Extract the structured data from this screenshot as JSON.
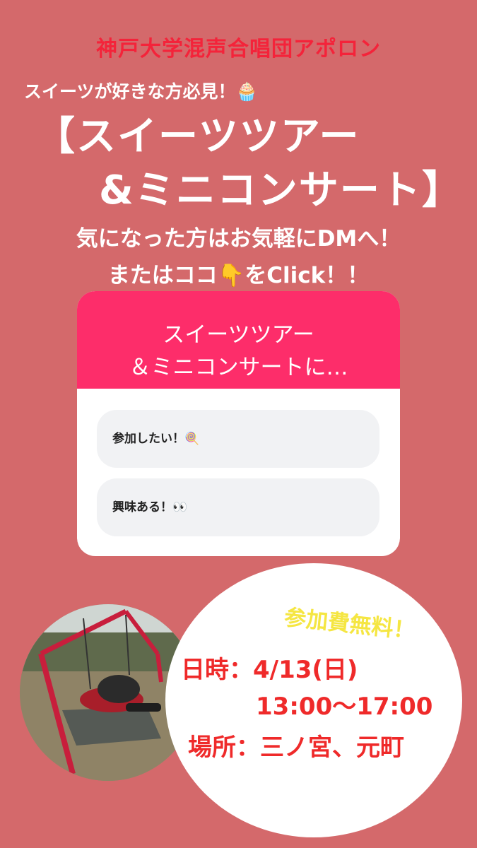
{
  "organization": "神戸大学混声合唱団アポロン",
  "tagline": "スイーツが好きな方必見！🧁",
  "title_line1": "【スイーツツアー",
  "title_line2": "&ミニコンサート】",
  "subtext_line1": "気になった方はお気軽にDMへ！",
  "subtext_line2": "またはココ👇をClick！！",
  "poll": {
    "question_line1": "スイーツツアー",
    "question_line2": "＆ミニコンサートに…",
    "options": [
      {
        "label": "参加したい！🍭"
      },
      {
        "label": "興味ある！👀"
      }
    ],
    "header_color": "#fd2d6a"
  },
  "info": {
    "fee": "参加費無料！",
    "date": "日時：4/13(日)",
    "time": "13:00〜17:00",
    "place": "場所：三ノ宮、元町"
  },
  "colors": {
    "background": "#d4696b",
    "accent_red": "#f4233a",
    "fee_yellow": "#f5e642"
  }
}
